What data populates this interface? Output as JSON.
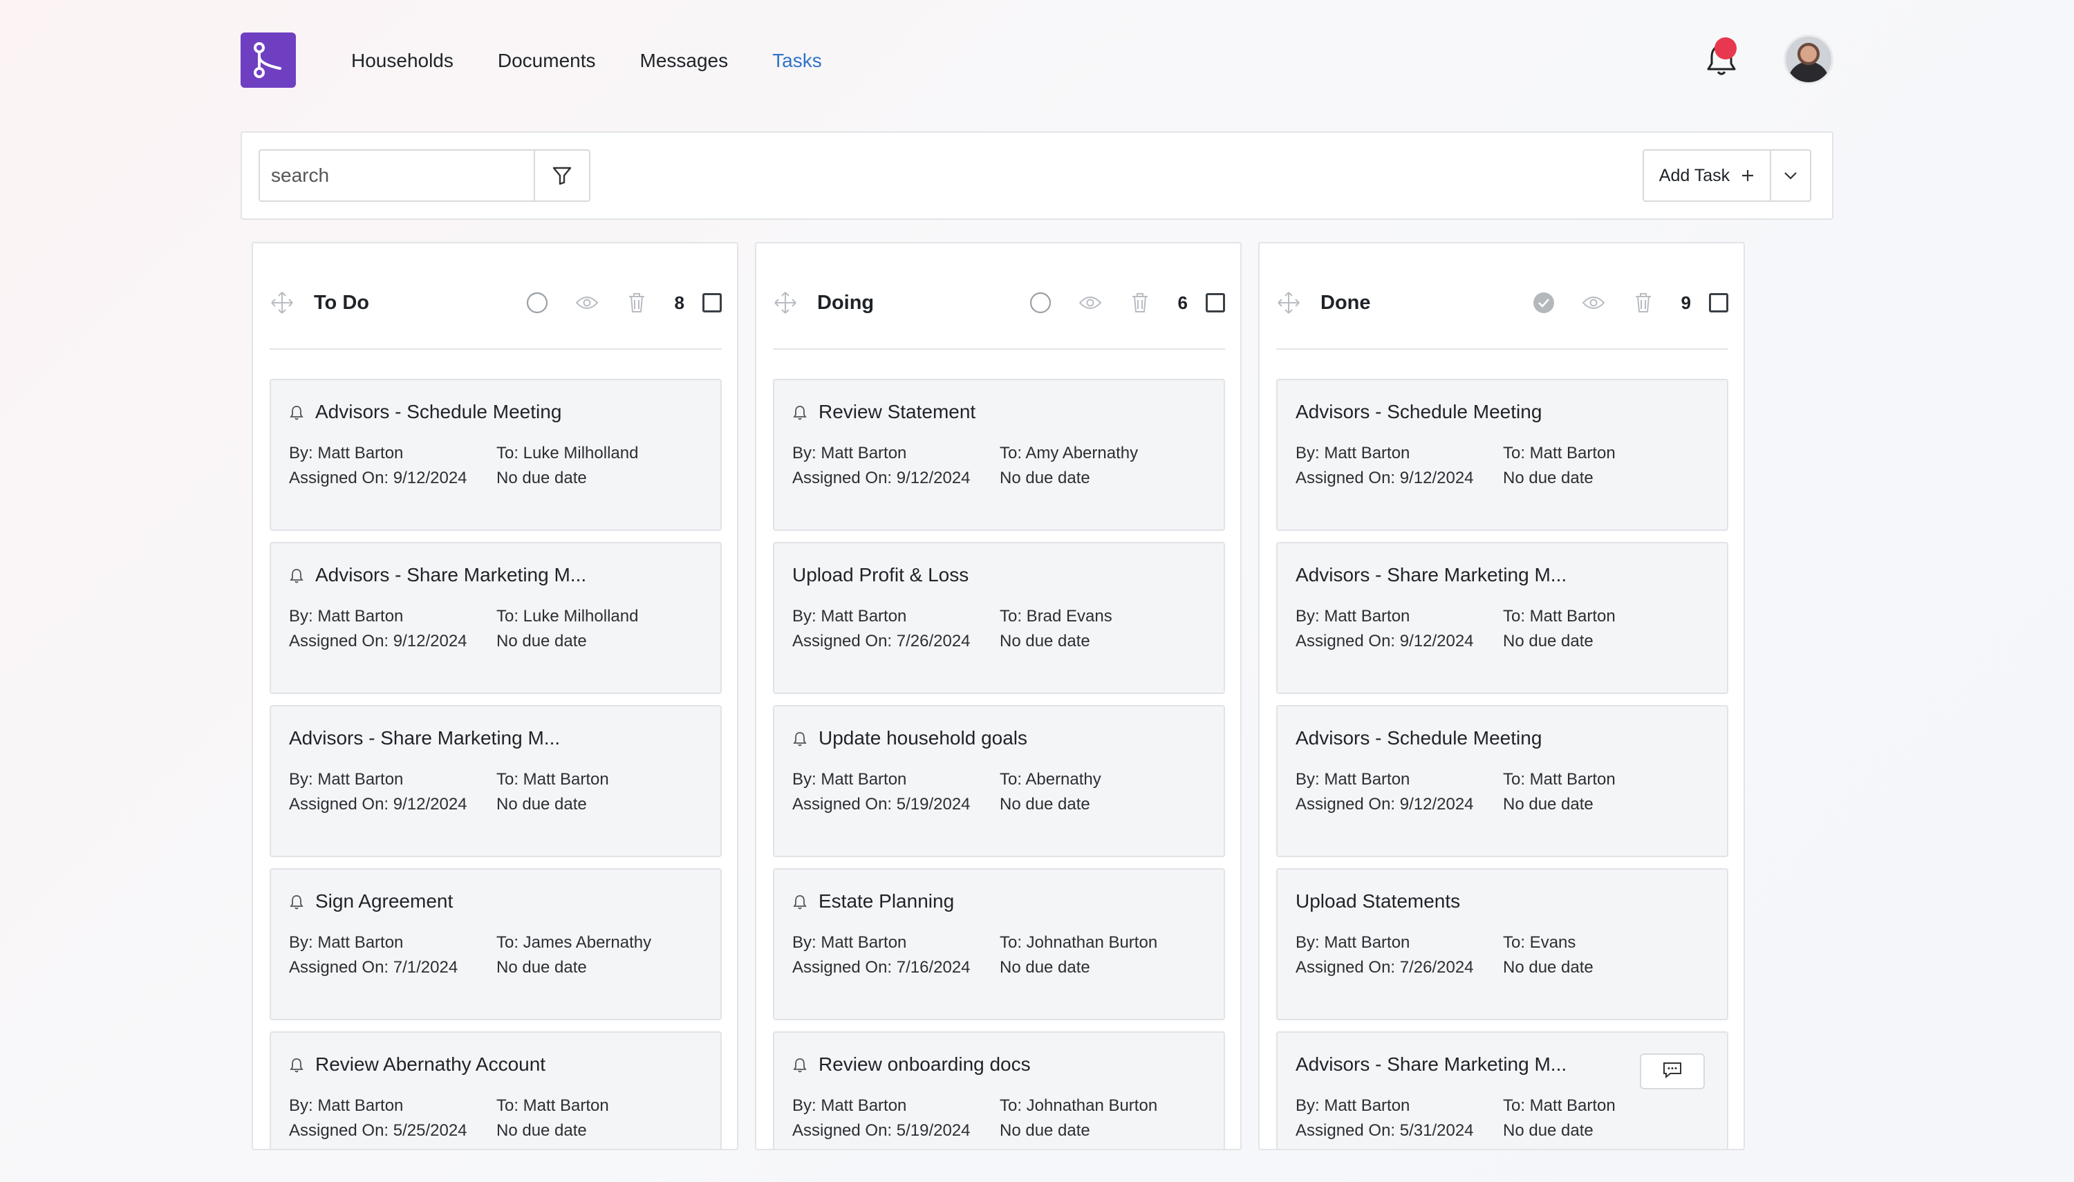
{
  "nav": {
    "items": [
      {
        "label": "Households",
        "active": false
      },
      {
        "label": "Documents",
        "active": false
      },
      {
        "label": "Messages",
        "active": false
      },
      {
        "label": "Tasks",
        "active": true
      }
    ]
  },
  "search": {
    "placeholder": "search"
  },
  "toolbar": {
    "add_task_label": "Add Task"
  },
  "columns": [
    {
      "title": "To Do",
      "count": "8",
      "cards": [
        {
          "title": "Advisors - Schedule Meeting",
          "bell": true,
          "by": "By: Matt Barton",
          "to": "To: Luke Milholland",
          "assigned": "Assigned On: 9/12/2024",
          "due": "No due date"
        },
        {
          "title": "Advisors - Share Marketing M...",
          "bell": true,
          "by": "By: Matt Barton",
          "to": "To: Luke Milholland",
          "assigned": "Assigned On: 9/12/2024",
          "due": "No due date"
        },
        {
          "title": "Advisors - Share Marketing M...",
          "bell": false,
          "by": "By: Matt Barton",
          "to": "To: Matt Barton",
          "assigned": "Assigned On: 9/12/2024",
          "due": "No due date"
        },
        {
          "title": "Sign Agreement",
          "bell": true,
          "by": "By: Matt Barton",
          "to": "To: James Abernathy",
          "assigned": "Assigned On: 7/1/2024",
          "due": "No due date"
        },
        {
          "title": "Review Abernathy Account",
          "bell": true,
          "by": "By: Matt Barton",
          "to": "To: Matt Barton",
          "assigned": "Assigned On: 5/25/2024",
          "due": "No due date"
        }
      ]
    },
    {
      "title": "Doing",
      "count": "6",
      "cards": [
        {
          "title": "Review Statement",
          "bell": true,
          "by": "By: Matt Barton",
          "to": "To: Amy Abernathy",
          "assigned": "Assigned On: 9/12/2024",
          "due": "No due date"
        },
        {
          "title": "Upload Profit & Loss",
          "bell": false,
          "by": "By: Matt Barton",
          "to": "To: Brad Evans",
          "assigned": "Assigned On: 7/26/2024",
          "due": "No due date"
        },
        {
          "title": "Update household goals",
          "bell": true,
          "by": "By: Matt Barton",
          "to": "To: Abernathy",
          "assigned": "Assigned On: 5/19/2024",
          "due": "No due date"
        },
        {
          "title": "Estate Planning",
          "bell": true,
          "by": "By: Matt Barton",
          "to": "To: Johnathan Burton",
          "assigned": "Assigned On: 7/16/2024",
          "due": "No due date"
        },
        {
          "title": "Review onboarding docs",
          "bell": true,
          "by": "By: Matt Barton",
          "to": "To: Johnathan Burton",
          "assigned": "Assigned On: 5/19/2024",
          "due": "No due date"
        }
      ]
    },
    {
      "title": "Done",
      "count": "9",
      "cards": [
        {
          "title": "Advisors - Schedule Meeting",
          "bell": false,
          "by": "By: Matt Barton",
          "to": "To: Matt Barton",
          "assigned": "Assigned On: 9/12/2024",
          "due": "No due date"
        },
        {
          "title": "Advisors - Share Marketing M...",
          "bell": false,
          "by": "By: Matt Barton",
          "to": "To: Matt Barton",
          "assigned": "Assigned On: 9/12/2024",
          "due": "No due date"
        },
        {
          "title": "Advisors - Schedule Meeting",
          "bell": false,
          "by": "By: Matt Barton",
          "to": "To: Matt Barton",
          "assigned": "Assigned On: 9/12/2024",
          "due": "No due date"
        },
        {
          "title": "Upload Statements",
          "bell": false,
          "by": "By: Matt Barton",
          "to": "To: Evans",
          "assigned": "Assigned On: 7/26/2024",
          "due": "No due date"
        },
        {
          "title": "Advisors - Share Marketing M...",
          "bell": false,
          "comment": true,
          "by": "By: Matt Barton",
          "to": "To: Matt Barton",
          "assigned": "Assigned On: 5/31/2024",
          "due": "No due date"
        }
      ]
    }
  ],
  "colors": {
    "brand": "#6f3fc2",
    "active_nav": "#2f74c7",
    "notification": "#e8384f"
  }
}
